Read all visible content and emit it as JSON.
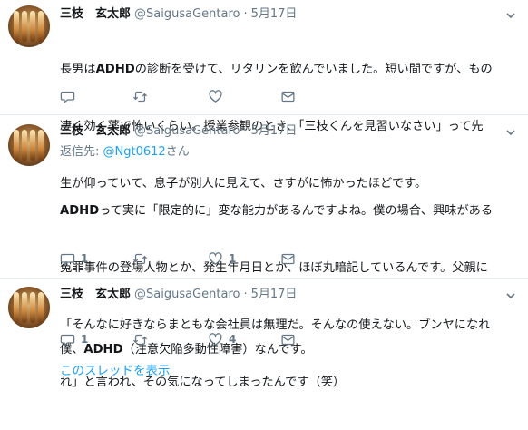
{
  "tweets": [
    {
      "name": "三枝　玄太郎",
      "handle": "@SaigusaGentaro",
      "separator": "·",
      "date": "5月17日",
      "text_lines": [
        [
          "長男は",
          "ADHD",
          "の診断を受けて、リタリンを飲んでいました。短い間ですが、もの"
        ],
        [
          "凄く効く薬で怖いくらい。授業参観のとき、「三枝くんを見習いなさい」って先"
        ],
        [
          "生が仰っていて、息子が別人に見えて、さすがに怖かったほどです。"
        ]
      ],
      "reply_count": "",
      "retweet_count": "",
      "like_count": ""
    },
    {
      "name": "三枝　玄太郎",
      "handle": "@SaigusaGentaro",
      "separator": "·",
      "date": "5月17日",
      "reply_to_prefix": "返信先: ",
      "reply_to_mention": "@Ngt0612",
      "reply_to_suffix": "さん",
      "text_lines": [
        [
          "",
          "ADHD",
          "って実に「限定的に」変な能力があるんですよね。僕の場合、興味がある"
        ],
        [
          "冤罪事件の登場人物とか、発生年月日とか、ほぼ丸暗記しているんです。父親に"
        ],
        [
          "「そんなに好きならまともな会社員は無理だ。そんなの使えない。ブンヤになれ"
        ],
        [
          "れ」と言われ、その気になってしまったんです（笑）"
        ]
      ],
      "reply_count": "1",
      "retweet_count": "",
      "like_count": "1"
    },
    {
      "name": "三枝　玄太郎",
      "handle": "@SaigusaGentaro",
      "separator": "·",
      "date": "5月17日",
      "text_lines": [
        [
          "僕、",
          "ADHD",
          "（注意欠陥多動性障害）なんです。"
        ]
      ],
      "reply_count": "1",
      "retweet_count": "",
      "like_count": "4"
    }
  ],
  "thread_link": "このスレッドを表示",
  "colors": {
    "link": "#1da1f2",
    "muted": "#657786",
    "text": "#14171a",
    "divider": "#e6ecf0"
  },
  "icons": [
    "avatar",
    "chevron-down-icon",
    "reply-icon",
    "retweet-icon",
    "like-icon",
    "message-icon"
  ]
}
